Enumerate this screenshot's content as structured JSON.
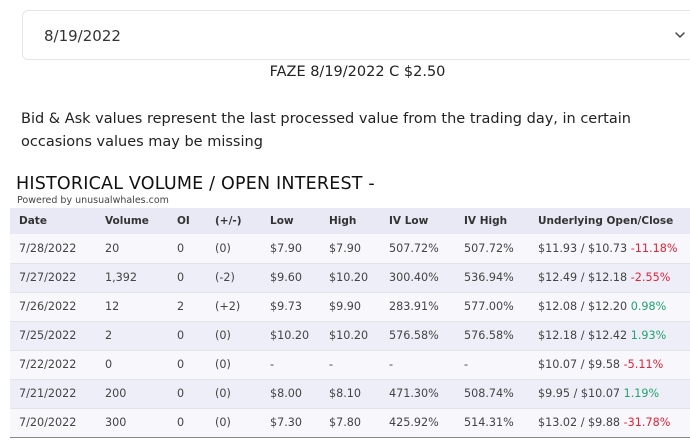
{
  "date_select": {
    "value": "8/19/2022",
    "icon": "chevron-down-icon"
  },
  "contract_title": "FAZE 8/19/2022 C $2.50",
  "notice": "Bid & Ask values represent the last processed value from the trading day, in certain occasions values may be missing",
  "section_heading": "HISTORICAL VOLUME / OPEN INTEREST -",
  "powered_by": "Powered by unusualwhales.com",
  "colors": {
    "positive": "#21a36b",
    "negative": "#e0243a",
    "header_bg": "#e9e9f5"
  },
  "table": {
    "headers": [
      "Date",
      "Volume",
      "OI",
      "(+/-)",
      "Low",
      "High",
      "IV Low",
      "IV High",
      "Underlying Open/Close"
    ],
    "rows": [
      {
        "date": "7/28/2022",
        "volume": "20",
        "oi": "0",
        "change": "(0)",
        "low": "$7.90",
        "high": "$7.90",
        "iv_low": "507.72%",
        "iv_high": "507.72%",
        "underlying": "$11.93 / $10.73",
        "underlying_pct": "-11.18%"
      },
      {
        "date": "7/27/2022",
        "volume": "1,392",
        "oi": "0",
        "change": "(-2)",
        "low": "$9.60",
        "high": "$10.20",
        "iv_low": "300.40%",
        "iv_high": "536.94%",
        "underlying": "$12.49 / $12.18",
        "underlying_pct": "-2.55%"
      },
      {
        "date": "7/26/2022",
        "volume": "12",
        "oi": "2",
        "change": "(+2)",
        "low": "$9.73",
        "high": "$9.90",
        "iv_low": "283.91%",
        "iv_high": "577.00%",
        "underlying": "$12.08 / $12.20",
        "underlying_pct": "0.98%"
      },
      {
        "date": "7/25/2022",
        "volume": "2",
        "oi": "0",
        "change": "(0)",
        "low": "$10.20",
        "high": "$10.20",
        "iv_low": "576.58%",
        "iv_high": "576.58%",
        "underlying": "$12.18 / $12.42",
        "underlying_pct": "1.93%"
      },
      {
        "date": "7/22/2022",
        "volume": "0",
        "oi": "0",
        "change": "(0)",
        "low": "-",
        "high": "-",
        "iv_low": "-",
        "iv_high": "-",
        "underlying": "$10.07 / $9.58",
        "underlying_pct": "-5.11%"
      },
      {
        "date": "7/21/2022",
        "volume": "200",
        "oi": "0",
        "change": "(0)",
        "low": "$8.00",
        "high": "$8.10",
        "iv_low": "471.30%",
        "iv_high": "508.74%",
        "underlying": "$9.95 / $10.07",
        "underlying_pct": "1.19%"
      },
      {
        "date": "7/20/2022",
        "volume": "300",
        "oi": "0",
        "change": "(0)",
        "low": "$7.30",
        "high": "$7.80",
        "iv_low": "425.92%",
        "iv_high": "514.31%",
        "underlying": "$13.02 / $9.88",
        "underlying_pct": "-31.78%"
      }
    ]
  }
}
